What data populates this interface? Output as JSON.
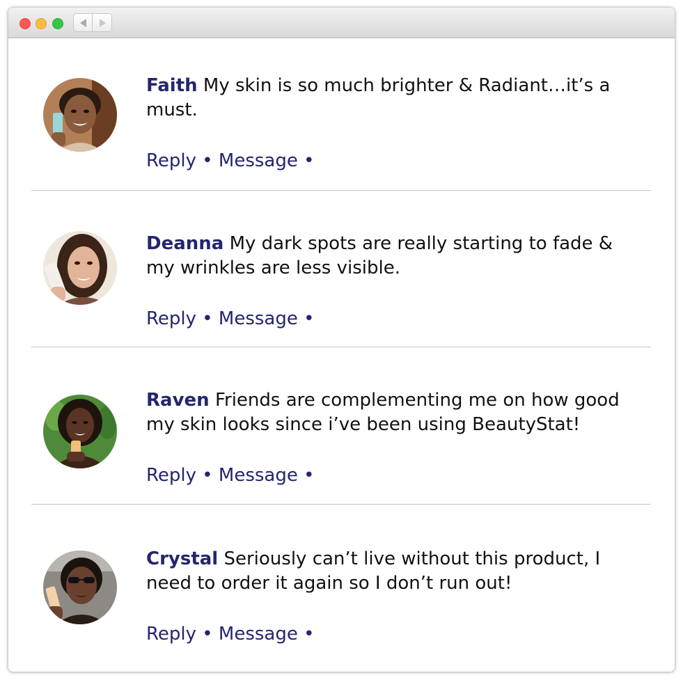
{
  "window": {
    "controls": [
      "close",
      "minimize",
      "maximize"
    ],
    "nav": {
      "back_icon": "left-triangle-icon",
      "forward_icon": "right-triangle-icon"
    }
  },
  "comments": [
    {
      "name": "Faith",
      "text": "My skin is so much brighter & Radiant…it’s a must.",
      "reply": "Reply",
      "message": "Message",
      "separator": "•",
      "avatar": {
        "skin": "#8a5a3c",
        "hair": "#2b1a10",
        "bg": "#b37f58",
        "shirt": "#d8c2a8",
        "product": "#9ad6d8"
      }
    },
    {
      "name": "Deanna",
      "text": "My dark spots are really starting to fade & my wrinkles are less visible.",
      "reply": "Reply",
      "message": "Message",
      "separator": "•",
      "avatar": {
        "skin": "#e2b49a",
        "hair": "#3a2418",
        "bg": "#efe6dc",
        "shirt": "#7a5040",
        "product": "#f3f0ec"
      }
    },
    {
      "name": "Raven",
      "text": "Friends are complementing me on how good my skin looks since i’ve been using BeautyStat!",
      "reply": "Reply",
      "message": "Message",
      "separator": "•",
      "avatar": {
        "skin": "#5a3424",
        "hair": "#1e140e",
        "bg": "#4f8a3a",
        "shirt": "#3a2418",
        "product": "#f0c07a"
      }
    },
    {
      "name": "Crystal",
      "text": "Seriously can’t live without this product, I need to order it again so I don’t run out!",
      "reply": "Reply",
      "message": "Message",
      "separator": "•",
      "avatar": {
        "skin": "#6a4030",
        "hair": "#1a120c",
        "bg": "#8d8a86",
        "shirt": "#2a1d16",
        "product": "#f2d2a8"
      }
    }
  ]
}
